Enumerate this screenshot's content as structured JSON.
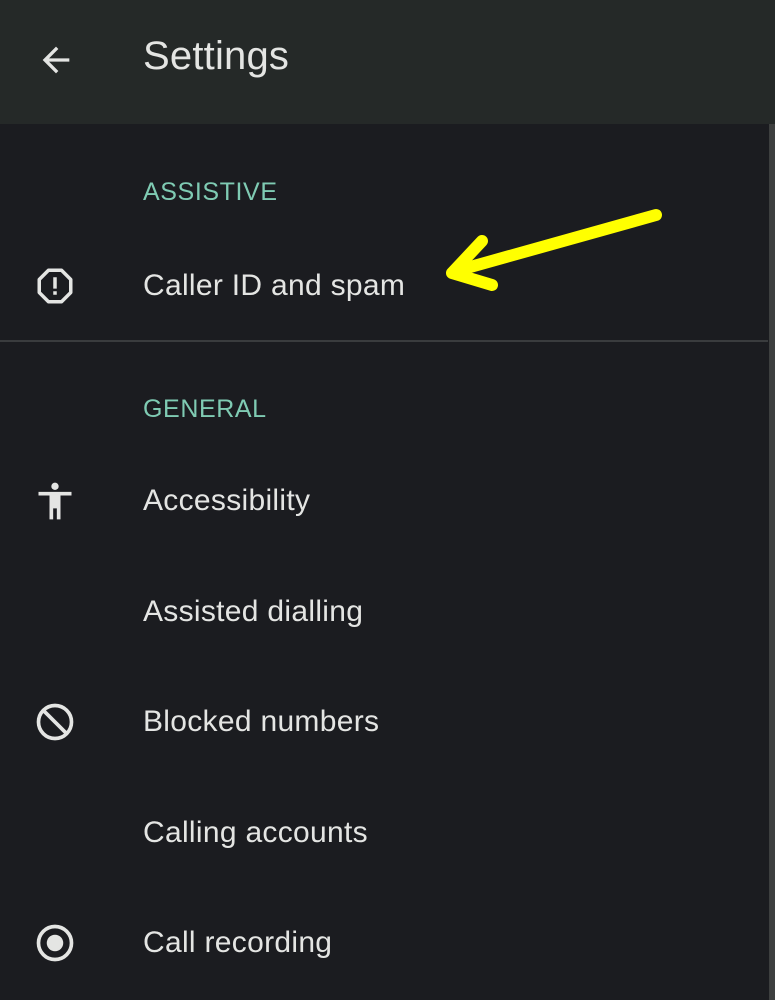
{
  "app_bar": {
    "back_icon": "arrow-left-icon",
    "title": "Settings"
  },
  "sections": {
    "assistive": {
      "header": "ASSISTIVE",
      "items": [
        {
          "label": "Caller ID and spam",
          "icon": "alert-octagon-icon"
        }
      ]
    },
    "general": {
      "header": "GENERAL",
      "items": [
        {
          "label": "Accessibility",
          "icon": "accessibility-icon"
        },
        {
          "label": "Assisted dialling",
          "icon": ""
        },
        {
          "label": "Blocked numbers",
          "icon": "block-icon"
        },
        {
          "label": "Calling accounts",
          "icon": ""
        },
        {
          "label": "Call recording",
          "icon": "radio-button-icon"
        }
      ]
    }
  },
  "colors": {
    "background": "#1b1c20",
    "app_bar": "#252928",
    "text": "#e4e5e3",
    "section_header": "#7fcbb3",
    "annotation_arrow": "#ffff00"
  }
}
